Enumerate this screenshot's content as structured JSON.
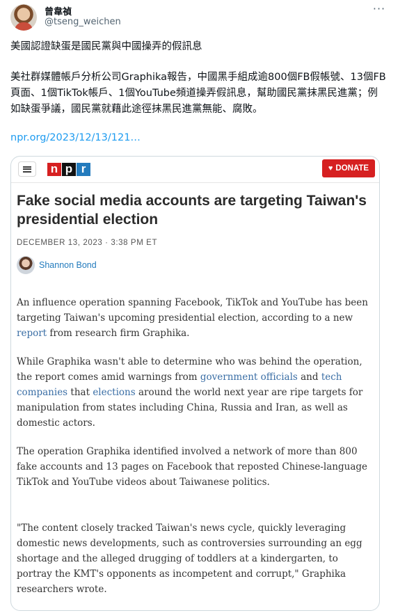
{
  "tweet": {
    "author_name": "曾韋禎",
    "author_handle": "@tseng_weichen",
    "line1": "美國認證缺蛋是國民黨與中國操弄的假訊息",
    "line2": "美社群媒體帳戶分析公司Graphika報告，中國黑手組成逾800個FB假帳號、13個FB頁面、1個TikTok帳戶、1個YouTube頻道操弄假訊息，幫助國民黨抹黑民進黨；例如缺蛋爭議，國民黨就藉此途徑抹黑民進黨無能、腐敗。",
    "link": "npr.org/2023/12/13/121…",
    "more_icon": "more-horizontal-icon"
  },
  "card": {
    "logo": {
      "n": "n",
      "p": "p",
      "r": "r"
    },
    "colors": {
      "npr_red": "#d62021",
      "npr_black": "#111111",
      "npr_blue": "#237bbd"
    },
    "donate_label": "DONATE",
    "headline": "Fake social media accounts are targeting Taiwan's presidential election",
    "dateline": "DECEMBER 13, 2023 · 3:38 PM ET",
    "author": "Shannon Bond",
    "p1": {
      "a": "An influence operation spanning Facebook, TikTok and YouTube has been targeting Taiwan's upcoming presidential election, according to a new ",
      "link": "report",
      "b": " from research firm Graphika."
    },
    "p2": {
      "a": "While Graphika wasn't able to determine who was behind the operation, the report comes amid warnings from ",
      "link1": "government officials",
      "b": " and ",
      "link2": "tech companies",
      "c": " that ",
      "link3": "elections",
      "d": " around the world next year are ripe targets for manipulation from states including China, Russia and Iran, as well as domestic actors."
    },
    "p3": "The operation Graphika identified involved a network of more than 800 fake accounts and 13 pages on Facebook that reposted Chinese-language TikTok and YouTube videos about Taiwanese politics.",
    "p4": "\"The content closely tracked Taiwan's news cycle, quickly leveraging domestic news developments, such as controversies surrounding an egg shortage and the alleged drugging of toddlers at a kindergarten, to portray the KMT's opponents as incompetent and corrupt,\" Graphika researchers wrote."
  }
}
